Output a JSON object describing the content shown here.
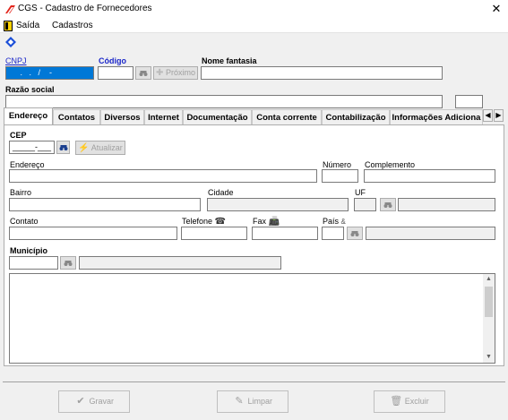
{
  "window": {
    "title": "CGS - Cadastro de Fornecedores",
    "close_glyph": "✕"
  },
  "menu": {
    "items": [
      {
        "label": "Saída",
        "mnemonic": "S"
      },
      {
        "label": "Cadastros",
        "mnemonic": "C"
      }
    ]
  },
  "header": {
    "cnpj_label": "CNPJ",
    "cnpj_value": "   .   .   /    -  ",
    "codigo_label": "Código",
    "codigo_value": "",
    "proximo_label": "Próximo",
    "nome_fantasia_label": "Nome fantasia",
    "nome_fantasia_value": "",
    "razao_social_label": "Razão social",
    "razao_social_value": "",
    "extra_field_value": ""
  },
  "tabs": [
    {
      "label": "Endereço",
      "active": true
    },
    {
      "label": "Contatos"
    },
    {
      "label": "Diversos"
    },
    {
      "label": "Internet"
    },
    {
      "label": "Documentação"
    },
    {
      "label": "Conta corrente"
    },
    {
      "label": "Contabilização"
    },
    {
      "label": "Informações Adiciona"
    }
  ],
  "tab_scroll": {
    "left": "◀",
    "right": "▶"
  },
  "endereco": {
    "cep_label": "CEP",
    "cep_value": "_____-___",
    "atualizar_label": "Atualizar",
    "endereco_label": "Endereço",
    "numero_label": "Número",
    "complemento_label": "Complemento",
    "bairro_label": "Bairro",
    "cidade_label": "Cidade",
    "uf_label": "UF",
    "contato_label": "Contato",
    "telefone_label": "Telefone",
    "fax_label": "Fax",
    "pais_label": "País",
    "municipio_label": "Município"
  },
  "footer": {
    "gravar_label": "Gravar",
    "limpar_label": "Limpar",
    "excluir_label": "Excluir"
  },
  "colors": {
    "accent_blue": "#1b27c9",
    "selection": "#0078d7",
    "panel_bg": "#ffffff",
    "window_bg": "#f0f0f0"
  }
}
